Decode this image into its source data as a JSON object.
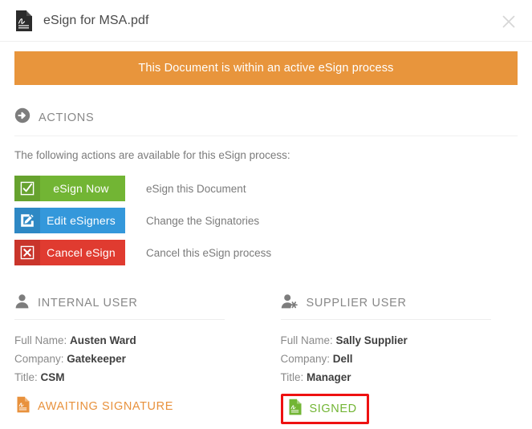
{
  "header": {
    "title": "eSign for MSA.pdf",
    "doc_icon": "signed-document-icon",
    "close_icon": "close-icon"
  },
  "banner": {
    "text": "This Document is within an active eSign process",
    "color": "#e8953c"
  },
  "actions_section": {
    "icon": "arrow-circle-right-icon",
    "title": "ACTIONS",
    "lead": "The following actions are available for this eSign process:",
    "items": [
      {
        "label": "eSign Now",
        "description": "eSign this Document",
        "color": "#72b534",
        "icon": "check-square-icon",
        "style": "btn-green"
      },
      {
        "label": "Edit eSigners",
        "description": "Change the Signatories",
        "color": "#3498db",
        "icon": "edit-pencil-square-icon",
        "style": "btn-blue"
      },
      {
        "label": "Cancel eSign",
        "description": "Cancel this eSign process",
        "color": "#e03b30",
        "icon": "x-square-icon",
        "style": "btn-red"
      }
    ]
  },
  "users": [
    {
      "icon": "user-icon",
      "title": "INTERNAL USER",
      "fields": [
        {
          "label": "Full Name:",
          "value": "Austen Ward"
        },
        {
          "label": "Company:",
          "value": "Gatekeeper"
        },
        {
          "label": "Title:",
          "value": "CSM"
        }
      ],
      "status": {
        "label": "AWAITING SIGNATURE",
        "icon": "document-awaiting-signature-icon",
        "color": "#e8913c",
        "highlighted": false
      }
    },
    {
      "icon": "user-gear-icon",
      "title": "SUPPLIER USER",
      "fields": [
        {
          "label": "Full Name:",
          "value": "Sally Supplier"
        },
        {
          "label": "Company:",
          "value": "Dell"
        },
        {
          "label": "Title:",
          "value": "Manager"
        }
      ],
      "status": {
        "label": "SIGNED",
        "icon": "document-signed-icon",
        "color": "#72b534",
        "highlighted": true,
        "highlight_color": "#ee1111"
      }
    }
  ]
}
